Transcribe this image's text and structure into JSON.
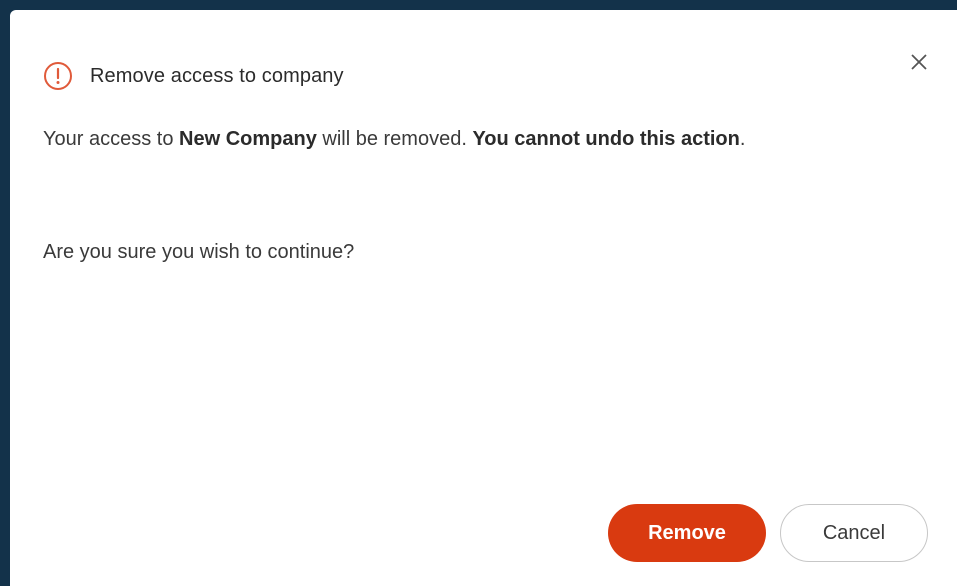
{
  "dialog": {
    "title": "Remove access to company",
    "message": {
      "part1": "Your access to ",
      "company": "New Company",
      "part2": " will be removed. ",
      "warning": "You cannot undo this action",
      "part3": "."
    },
    "question": "Are you sure you wish to continue?",
    "remove_label": "Remove",
    "cancel_label": "Cancel",
    "icon": "warning-circle-icon",
    "close_icon": "close-icon"
  },
  "colors": {
    "backdrop": "#13324a",
    "danger": "#d93a10",
    "warning_icon": "#e05a3a"
  }
}
